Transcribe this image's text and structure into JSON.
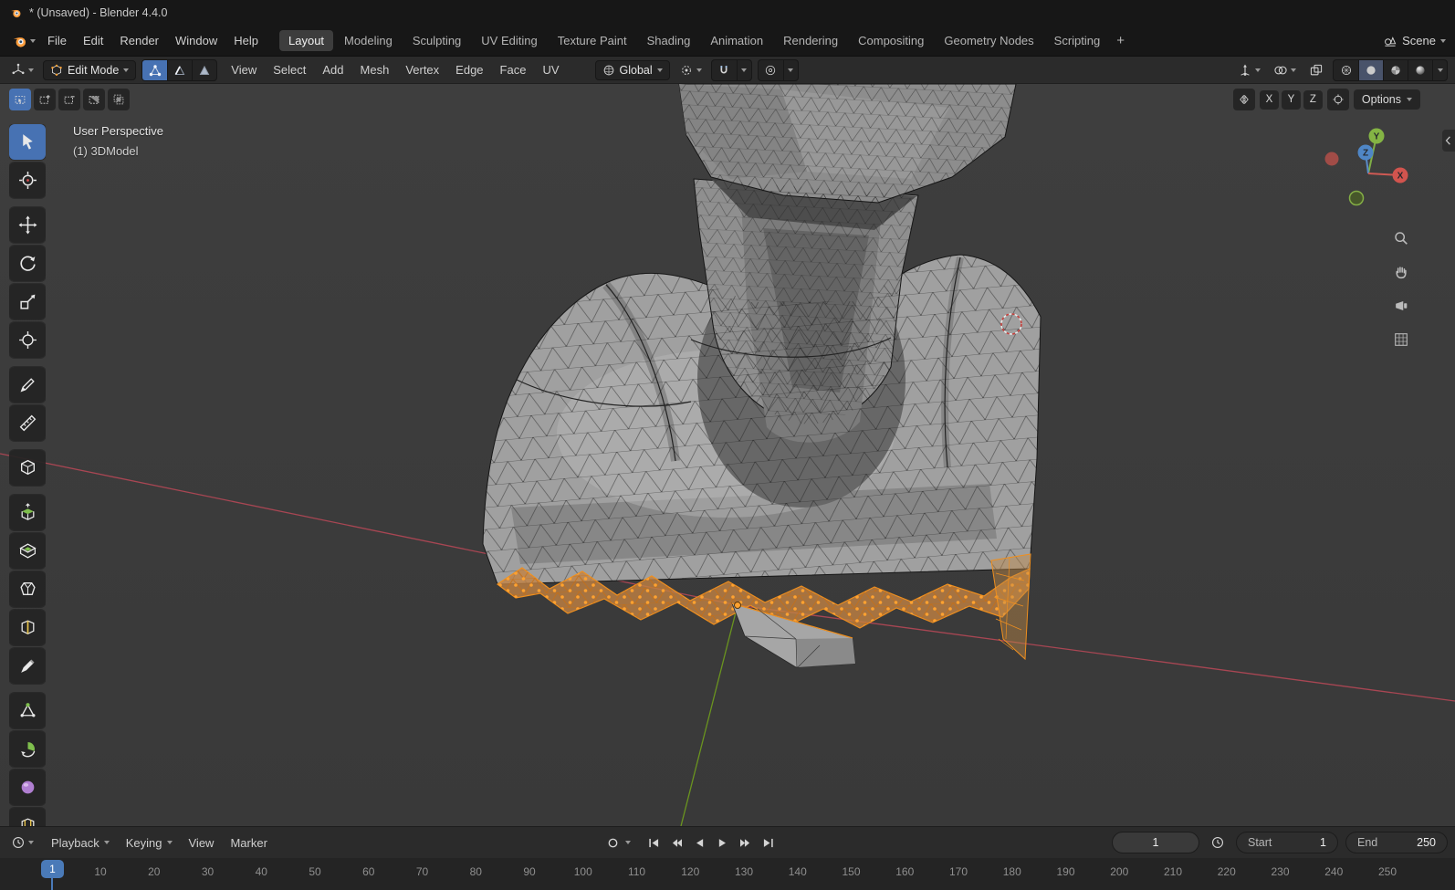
{
  "title_bar": {
    "app_title": "* (Unsaved) - Blender 4.4.0"
  },
  "topbar": {
    "menus": [
      "File",
      "Edit",
      "Render",
      "Window",
      "Help"
    ],
    "workspaces": [
      {
        "label": "Layout",
        "active": true
      },
      {
        "label": "Modeling"
      },
      {
        "label": "Sculpting"
      },
      {
        "label": "UV Editing"
      },
      {
        "label": "Texture Paint"
      },
      {
        "label": "Shading"
      },
      {
        "label": "Animation"
      },
      {
        "label": "Rendering"
      },
      {
        "label": "Compositing"
      },
      {
        "label": "Geometry Nodes"
      },
      {
        "label": "Scripting"
      }
    ],
    "add_workspace_label": "+",
    "scene_label": "Scene"
  },
  "viewport_header": {
    "mode_label": "Edit Mode",
    "menus": [
      "View",
      "Select",
      "Add",
      "Mesh",
      "Vertex",
      "Edge",
      "Face",
      "UV"
    ],
    "orientation_label": "Global"
  },
  "tool_settings": {
    "mirror_axes": [
      "X",
      "Y",
      "Z"
    ],
    "options_label": "Options"
  },
  "left_toolbar": {
    "tools": [
      {
        "name": "tweak",
        "active": true
      },
      {
        "name": "cursor"
      },
      {
        "name": "move"
      },
      {
        "name": "rotate"
      },
      {
        "name": "scale"
      },
      {
        "name": "transform"
      },
      {
        "name": "annotate"
      },
      {
        "name": "measure"
      },
      {
        "name": "add-cube"
      },
      {
        "name": "extrude"
      },
      {
        "name": "inset"
      },
      {
        "name": "bevel"
      },
      {
        "name": "loop-cut"
      },
      {
        "name": "knife"
      },
      {
        "name": "poly-build"
      },
      {
        "name": "spin"
      },
      {
        "name": "smooth"
      },
      {
        "name": "edge-slide"
      }
    ]
  },
  "viewport": {
    "perspective_label": "User Perspective",
    "object_label": "(1) 3DModel",
    "gizmo": {
      "x": "X",
      "y": "Y",
      "z": "Z"
    }
  },
  "timeline": {
    "menus": [
      {
        "label": "Playback",
        "caret": true
      },
      {
        "label": "Keying",
        "caret": true
      },
      {
        "label": "View"
      },
      {
        "label": "Marker"
      }
    ],
    "current_frame": "1",
    "start_label": "Start",
    "start_value": "1",
    "end_label": "End",
    "end_value": "250",
    "playhead_frame": "1",
    "ticks": [
      "10",
      "20",
      "30",
      "40",
      "50",
      "60",
      "70",
      "80",
      "90",
      "100",
      "110",
      "120",
      "130",
      "140",
      "150",
      "160",
      "170",
      "180",
      "190",
      "200",
      "210",
      "220",
      "230",
      "240",
      "250"
    ]
  },
  "colors": {
    "accent_blue": "#4772b3",
    "selection_orange": "#ffa230",
    "axis_x_red": "#a84653",
    "axis_y_green": "#6a941f",
    "viewport_bg": "#3c3c3c"
  },
  "icons": [
    "blender-logo",
    "editor-3d-viewport",
    "edit-mode-cube",
    "vertex-select",
    "edge-select",
    "face-select",
    "orientation-globe",
    "pivot-point",
    "snap-magnet",
    "proportional-circle",
    "gizmo-arrow",
    "overlays-circles",
    "xray-squares",
    "shading-wireframe",
    "shading-solid",
    "shading-material",
    "shading-rendered",
    "scene",
    "clock",
    "auto-key-circle",
    "jump-start",
    "prev-keyframe",
    "play-reverse",
    "play",
    "next-keyframe",
    "jump-end",
    "magnifier",
    "hand",
    "camera",
    "grid",
    "sidebar-arrow",
    "mirror",
    "snap-target"
  ]
}
